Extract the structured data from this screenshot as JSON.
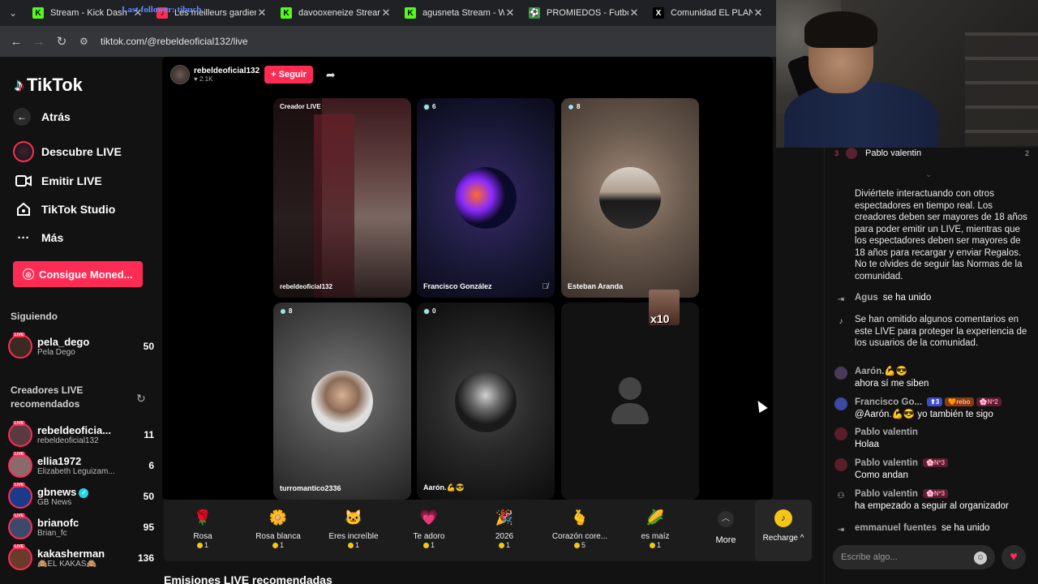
{
  "browser": {
    "tabs": [
      {
        "title": "Stream - Kick Dash",
        "icon": "kick-icon",
        "color": "#53fc18",
        "glyph": "K"
      },
      {
        "title": "Les meilleurs gardiens",
        "icon": "tiktok-tab-icon",
        "color": "#fe2c55",
        "glyph": "♪"
      },
      {
        "title": "davooxeneize Stream",
        "icon": "kick-icon",
        "color": "#53fc18",
        "glyph": "K"
      },
      {
        "title": "agusneta Stream - Wa",
        "icon": "kick-icon",
        "color": "#53fc18",
        "glyph": "K"
      },
      {
        "title": "PROMIEDOS - Futbol a",
        "icon": "promiedos-icon",
        "color": "#2e9d3b",
        "glyph": "⚽"
      },
      {
        "title": "Comunidad EL PLANE",
        "icon": "x-icon",
        "color": "#000000",
        "glyph": "X"
      }
    ],
    "overlay_text": "Last follower: tibuch",
    "url": "tiktok.com/@rebeldeoficial132/live"
  },
  "sidebar": {
    "logo": "TikTok",
    "nav": [
      {
        "label": "Atrás",
        "icon": "arrow-left-icon"
      },
      {
        "label": "Descubre LIVE",
        "icon": "live-avatar-icon"
      },
      {
        "label": "Emitir LIVE",
        "icon": "video-camera-icon"
      },
      {
        "label": "TikTok Studio",
        "icon": "studio-icon"
      },
      {
        "label": "Más",
        "icon": "more-dots-icon"
      }
    ],
    "coins_button": "Consigue Moned...",
    "following_title": "Siguiendo",
    "following": [
      {
        "name": "pela_dego",
        "sub": "Pela Dego",
        "count": "50",
        "color": "#3a2a22"
      }
    ],
    "recommended_title": "Creadores LIVE recomendados",
    "recommended": [
      {
        "name": "rebeldeoficia...",
        "sub": "rebeldeoficial132",
        "count": "11",
        "color": "#5a3a3e"
      },
      {
        "name": "ellia1972",
        "sub": "Elizabeth Leguizam...",
        "count": "6",
        "color": "#8a6a6a"
      },
      {
        "name": "gbnews",
        "sub": "GB News",
        "count": "50",
        "color": "#1a3a8a",
        "verified": true
      },
      {
        "name": "brianofc",
        "sub": "Brian_fc",
        "count": "95",
        "color": "#3a4a6a"
      },
      {
        "name": "kakasherman",
        "sub": "🙈EL KAKAS🙈",
        "count": "136",
        "color": "#6a3a2a"
      }
    ],
    "live_tag": "LIVE"
  },
  "stream": {
    "host": "rebeldeoficial132",
    "likes": "♥ 2.1K",
    "follow_label": "+ Seguir",
    "tiles": [
      {
        "top": "Creador LIVE",
        "bottom": "rebeldeoficial132",
        "count": ""
      },
      {
        "top": "6",
        "bottom": "Francisco González",
        "count": "6"
      },
      {
        "top": "8",
        "bottom": "Esteban Aranda",
        "count": "8"
      },
      {
        "top": "8",
        "bottom": "turromantico2336",
        "count": "8"
      },
      {
        "top": "0",
        "bottom": "Aarón.💪😎",
        "count": "0"
      },
      {
        "top": "",
        "bottom": "",
        "count": ""
      }
    ],
    "overlay_badge": "x10"
  },
  "gifts": [
    {
      "name": "Rosa",
      "price": "1",
      "glyph": "🌹"
    },
    {
      "name": "Rosa blanca",
      "price": "1",
      "glyph": "🌼"
    },
    {
      "name": "Eres increíble",
      "price": "1",
      "glyph": "🐱"
    },
    {
      "name": "Te adoro",
      "price": "1",
      "glyph": "💗"
    },
    {
      "name": "2026",
      "price": "1",
      "glyph": "🎉"
    },
    {
      "name": "Corazón core...",
      "price": "5",
      "glyph": "🫰"
    },
    {
      "name": "es maíz",
      "price": "1",
      "glyph": "🌽"
    }
  ],
  "gift_more": "More",
  "recharge": "Recharge ^",
  "section_heading": "Emisiones LIVE recomendadas",
  "chat": {
    "top_rank": "3",
    "top_user": "Pablo valentin",
    "top_count": "2",
    "messages": [
      {
        "type": "system",
        "icon": "info-icon",
        "text": "Diviértete interactuando con otros espectadores en tiempo real. Los creadores deben ser mayores de 18 años para poder emitir un LIVE, mientras que los espectadores deben ser mayores de 18 años para recargar y enviar Regalos. No te olvides de seguir las Normas de la comunidad."
      },
      {
        "type": "join",
        "icon": "enter-icon",
        "user": "Agus",
        "text": "se ha unido"
      },
      {
        "type": "system",
        "icon": "tiktok-note-icon",
        "text": "Se han omitido algunos comentarios en este LIVE para proteger la experiencia de los usuarios de la comunidad."
      },
      {
        "type": "chat",
        "icon": "avatar",
        "user": "Aarón.💪😎",
        "badges": [],
        "text": "ahora sí me siben"
      },
      {
        "type": "chat",
        "icon": "avatar",
        "user": "Francisco Go...",
        "badges": [
          "⬆3",
          "🧡rebo",
          "🌸Nº2"
        ],
        "text": "@Aarón.💪😎 yo también te sigo"
      },
      {
        "type": "chat",
        "icon": "avatar",
        "user": "Pablo valentin",
        "badges": [],
        "text": "Holaa"
      },
      {
        "type": "chat",
        "icon": "avatar",
        "user": "Pablo valentin",
        "badges": [
          "🌸Nº3"
        ],
        "text": "Como andan"
      },
      {
        "type": "follow",
        "icon": "follow-user-icon",
        "user": "Pablo valentin",
        "badges": [
          "🌸Nº3"
        ],
        "text": "ha empezado a seguir al organizador"
      },
      {
        "type": "join",
        "icon": "enter-icon",
        "user": "emmanuel fuentes",
        "text": "se ha unido"
      }
    ],
    "input_placeholder": "Escribe algo..."
  }
}
